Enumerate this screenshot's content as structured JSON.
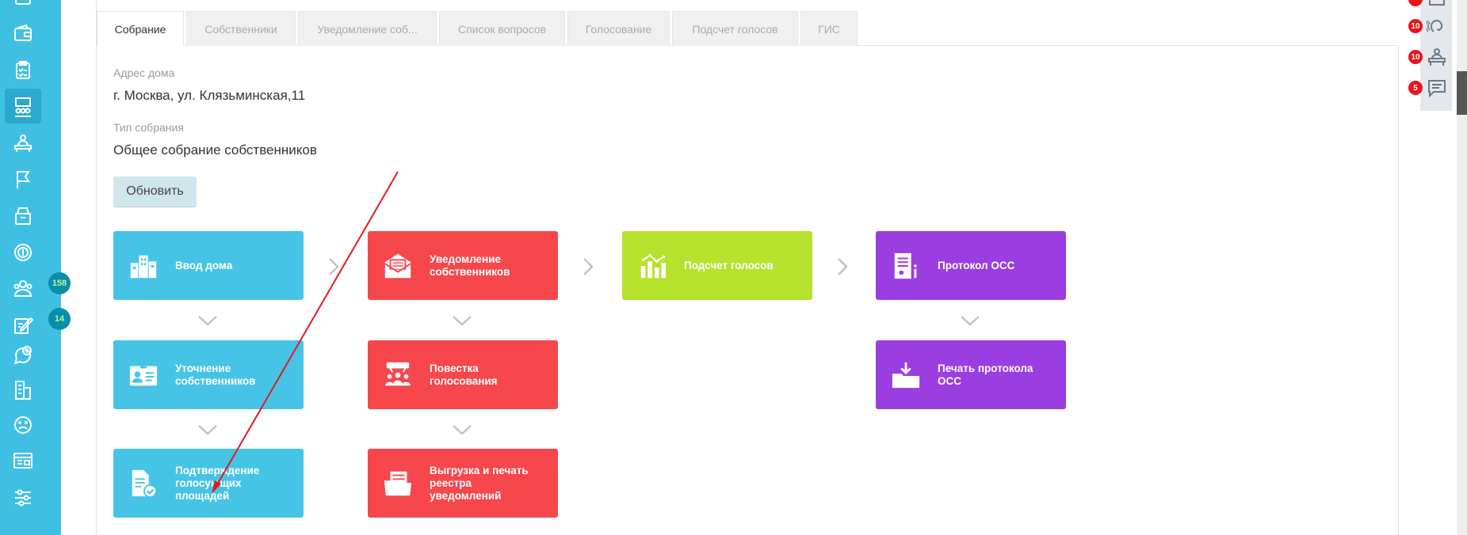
{
  "sidebar": {
    "badges": [
      {
        "value": "158"
      },
      {
        "value": "14"
      }
    ],
    "icons": [
      "wallet-icon",
      "checklist-icon",
      "meeting-icon",
      "reception-icon",
      "flag-icon",
      "archive-icon",
      "coin-icon",
      "owners-icon",
      "edit-icon",
      "chat-plus-icon",
      "building-icon",
      "sad-face-icon",
      "dashboard-icon",
      "settings-icon"
    ]
  },
  "tabs": [
    {
      "label": "Собрание",
      "active": true
    },
    {
      "label": "Собственники"
    },
    {
      "label": "Уведомление соб..."
    },
    {
      "label": "Список вопросов"
    },
    {
      "label": "Голосование"
    },
    {
      "label": "Подсчет голосов"
    },
    {
      "label": "ГИС"
    }
  ],
  "house": {
    "label": "Адрес дома",
    "value": "г. Москва, ул. Клязьминская,11"
  },
  "meeting_type": {
    "label": "Тип собрания",
    "value": "Общее собрание собственников"
  },
  "update_button": "Обновить",
  "tiles": {
    "house_input": {
      "line1": "Ввод дома",
      "line2": ""
    },
    "owners_notice": {
      "line1": "Уведомление",
      "line2": "собственников"
    },
    "vote_count": {
      "line1": "Подсчет голосов",
      "line2": ""
    },
    "protocol": {
      "line1": "Протокол ОСС",
      "line2": ""
    },
    "owners_refine": {
      "line1": "Уточнение",
      "line2": "собственников"
    },
    "agenda": {
      "line1": "Повестка",
      "line2": "голосования"
    },
    "protocol_print": {
      "line1": "Печать протокола",
      "line2": "ОСС"
    },
    "area_confirm": {
      "line1": "Подтверждение",
      "line2": "голосующих",
      "line3": "площадей"
    },
    "export_print": {
      "line1": "Выгрузка и печать",
      "line2": "реестра",
      "line3": "уведомлений"
    }
  },
  "right_rail": {
    "badges": [
      {
        "value": "10"
      },
      {
        "value": "10"
      },
      {
        "value": "5"
      }
    ],
    "icons": [
      "notification-icon",
      "call-icon",
      "reception-icon",
      "message-icon"
    ]
  },
  "colors": {
    "sidebar": "#3fc0e3",
    "blue": "#45c4e6",
    "red": "#f5474c",
    "lime": "#b5e22c",
    "purple": "#9a3ee2",
    "arrow": "#e01b22"
  }
}
